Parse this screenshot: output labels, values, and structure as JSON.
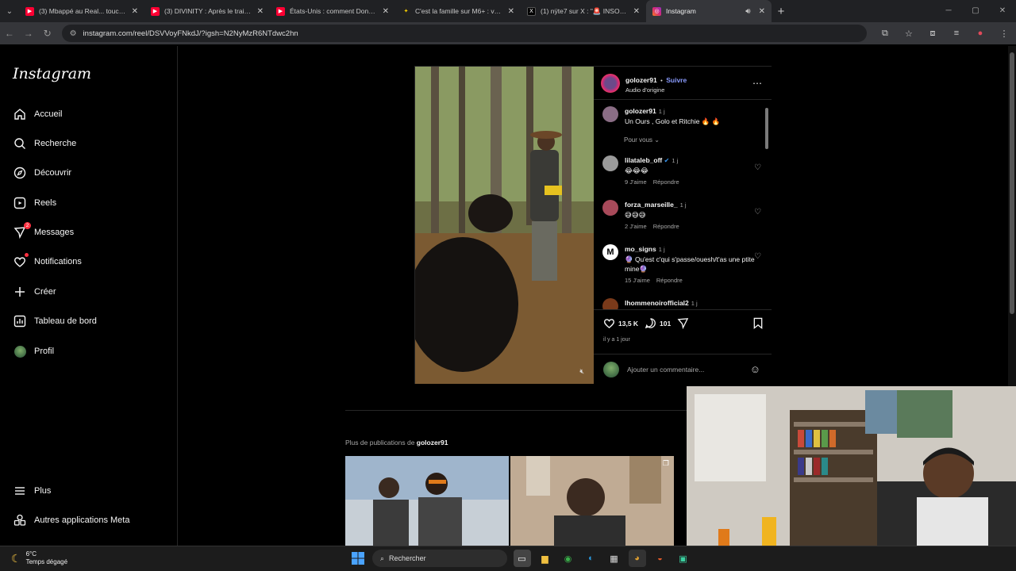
{
  "tabs": [
    {
      "title": "(3) Mbappé au Real... touché p...",
      "favicon": "youtube-icon",
      "color": "#ff0033"
    },
    {
      "title": "(3) DIVINITY : Après le trailer, La...",
      "favicon": "youtube-icon",
      "color": "#ff0033"
    },
    {
      "title": "États-Unis : comment Donald T...",
      "favicon": "youtube-icon",
      "color": "#ff0033"
    },
    {
      "title": "C'est la famille sur M6+ : voir le...",
      "favicon": "m6-icon",
      "color": "#111111"
    },
    {
      "title": "(1) nÿte7 sur X : \"🚨 INSOLITE |...",
      "favicon": "x-icon",
      "color": "#000000"
    },
    {
      "title": "Instagram",
      "favicon": "instagram-icon",
      "color": "#d62976",
      "active": true
    }
  ],
  "address_bar": {
    "url": "instagram.com/reel/DSVVoyFNkdJ/?igsh=N2NyMzR6NTdwc2hn"
  },
  "sidebar": {
    "logo": "Instagram",
    "items": [
      {
        "label": "Accueil",
        "icon": "home-icon"
      },
      {
        "label": "Recherche",
        "icon": "search-icon"
      },
      {
        "label": "Découvrir",
        "icon": "compass-icon"
      },
      {
        "label": "Reels",
        "icon": "reels-icon"
      },
      {
        "label": "Messages",
        "icon": "messenger-icon",
        "badge": "2"
      },
      {
        "label": "Notifications",
        "icon": "heart-icon"
      },
      {
        "label": "Créer",
        "icon": "plus-icon"
      },
      {
        "label": "Tableau de bord",
        "icon": "dashboard-icon"
      },
      {
        "label": "Profil",
        "icon": "profile-avatar"
      }
    ],
    "bottom": [
      {
        "label": "Plus",
        "icon": "menu-icon"
      },
      {
        "label": "Autres applications Meta",
        "icon": "meta-apps-icon"
      }
    ]
  },
  "post": {
    "author": "golozer91",
    "follow": "Suivre",
    "separator": "•",
    "audio": "Audio d'origine",
    "caption": {
      "user": "golozer91",
      "time": "1 j",
      "text": "Un Ours , Golo et Ritchie 🔥 🔥"
    },
    "sort_label": "Pour vous",
    "comments": [
      {
        "user": "lilataleb_off",
        "verified": true,
        "time": "1 j",
        "text": "😂😂😂",
        "likes": "9 J'aime",
        "reply": "Répondre"
      },
      {
        "user": "forza_marseille_",
        "time": "1 j",
        "text": "😅😅😅",
        "likes": "2 J'aime",
        "reply": "Répondre"
      },
      {
        "user": "mo_signs",
        "time": "1 j",
        "text": "🔮 Qu'est c'qui s'passe/ouesh/t'as une ptite mine🔮",
        "likes": "15 J'aime",
        "reply": "Répondre"
      },
      {
        "user": "lhommenoirofficial2",
        "time": "1 j",
        "text": ""
      }
    ],
    "likes_count": "13,5 K",
    "comments_count": "101",
    "posted": "il y a 1 jour",
    "add_comment_placeholder": "Ajouter un commentaire..."
  },
  "more": {
    "prefix": "Plus de publications de",
    "user": "golozer91"
  },
  "taskbar": {
    "temp": "6°C",
    "weather": "Temps dégagé",
    "search": "Rechercher"
  }
}
